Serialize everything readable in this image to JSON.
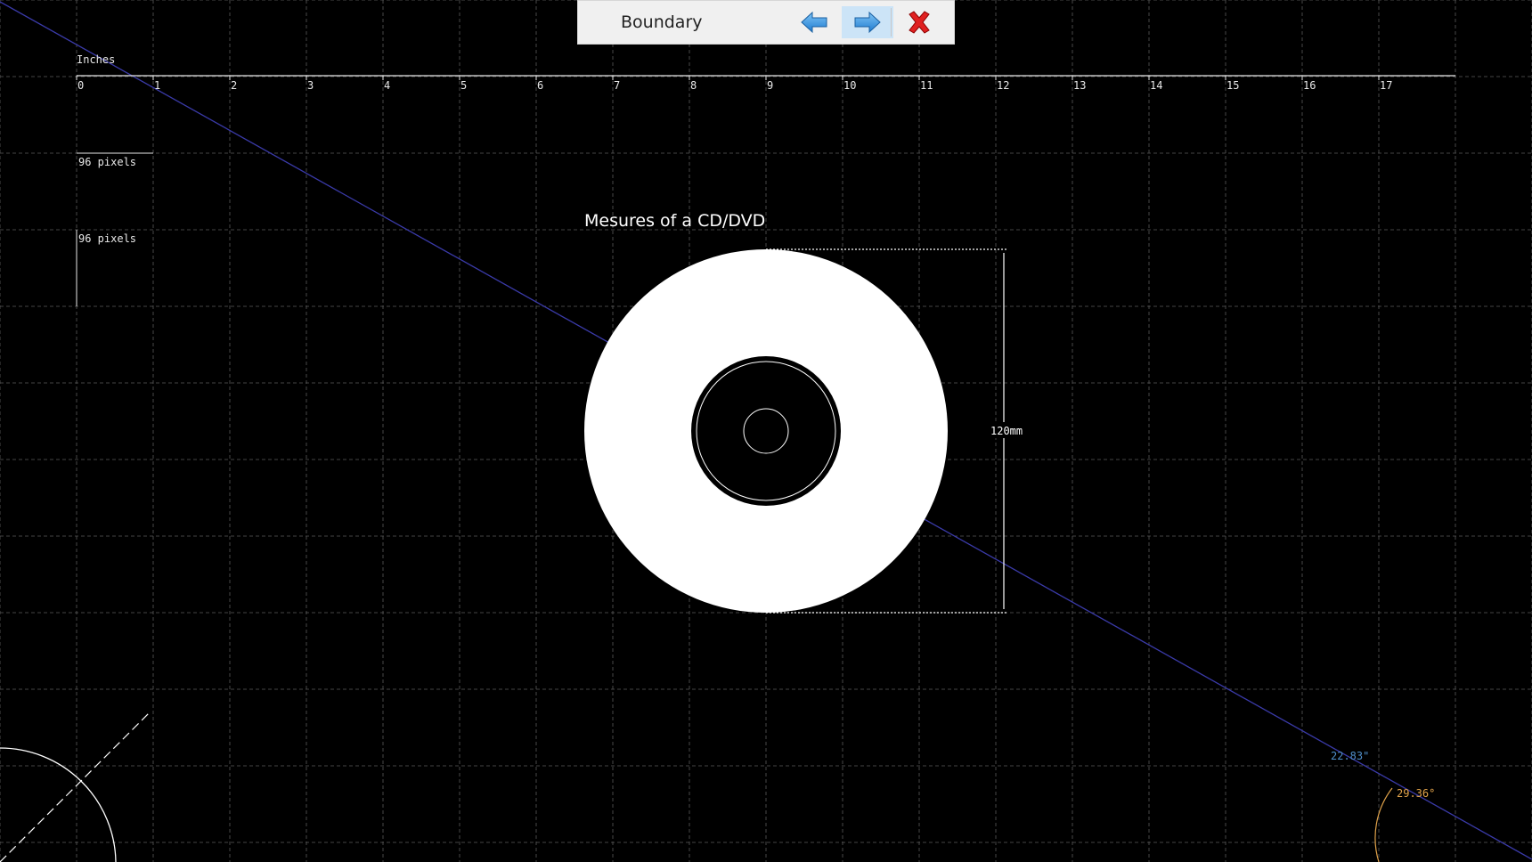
{
  "toolbar": {
    "title": "Boundary",
    "back_icon": "arrow-left-icon",
    "forward_icon": "arrow-right-icon",
    "close_icon": "close-x-icon"
  },
  "ruler": {
    "unit_label": "Inches",
    "ticks": [
      "0",
      "1",
      "2",
      "3",
      "4",
      "5",
      "6",
      "7",
      "8",
      "9",
      "10",
      "11",
      "12",
      "13",
      "14",
      "15",
      "16",
      "17"
    ]
  },
  "scale_bars": {
    "horizontal_label": "96 pixels",
    "vertical_label": "96 pixels"
  },
  "drawing": {
    "title": "Mesures of a CD/DVD",
    "dimension_label": "120mm"
  },
  "measurement": {
    "length": "22.83\"",
    "angle": "29.36°"
  },
  "colors": {
    "background": "#000000",
    "grid": "#5a5a5a",
    "disc": "#ffffff",
    "measure_line": "#3a3aa8",
    "length_text": "#4f8ec9",
    "angle_text": "#e0a24a"
  }
}
